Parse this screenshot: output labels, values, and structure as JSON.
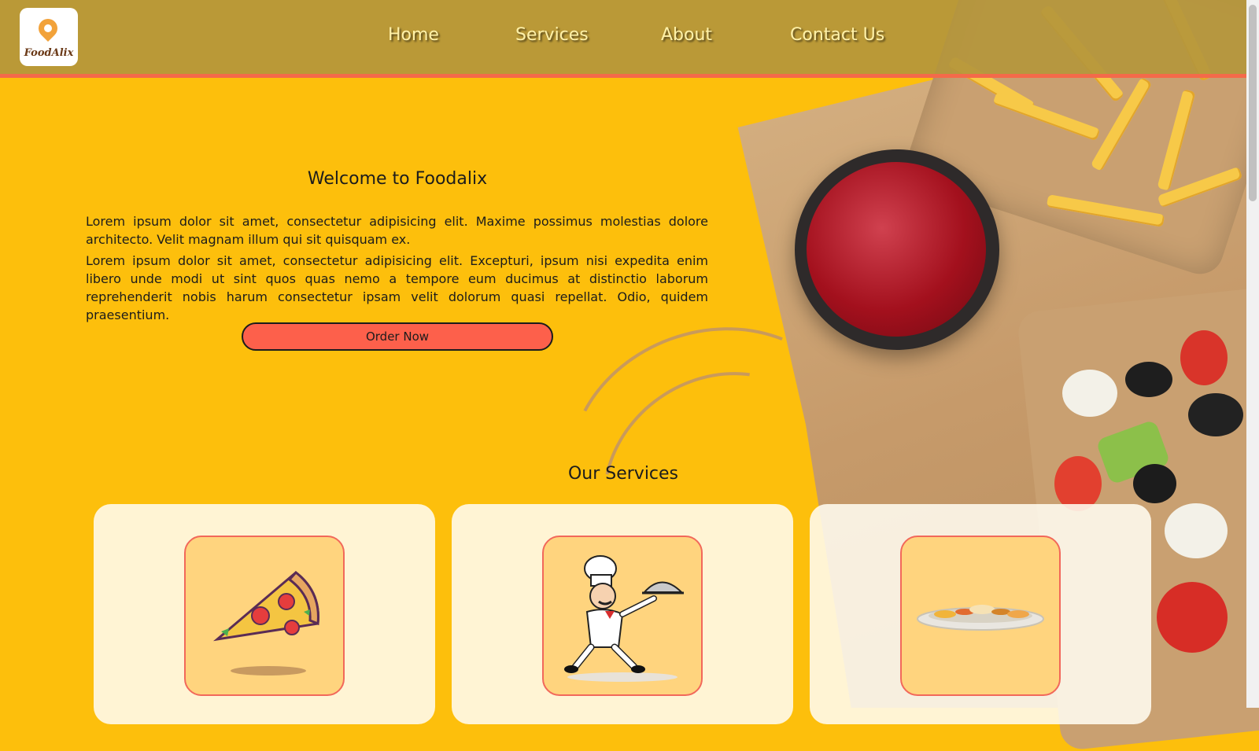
{
  "brand": {
    "logo_text": "FoodAlix"
  },
  "nav": {
    "items": [
      {
        "label": "Home"
      },
      {
        "label": "Services"
      },
      {
        "label": "About"
      },
      {
        "label": "Contact Us"
      }
    ]
  },
  "hero": {
    "title": "Welcome to Foodalix",
    "paragraph1": "Lorem ipsum dolor sit amet, consectetur adipisicing elit. Maxime possimus molestias dolore architecto. Velit magnam illum qui sit quisquam ex.",
    "paragraph2": "Lorem ipsum dolor sit amet, consectetur adipisicing elit. Excepturi, ipsum nisi expedita enim libero unde modi ut sint quos quas nemo a tempore eum ducimus at distinctio laborum reprehenderit nobis harum consectetur ipsam velit dolorum quasi repellat. Odio, quidem praesentium.",
    "order_button": "Order Now"
  },
  "services": {
    "title": "Our Services",
    "cards": [
      {
        "icon": "pizza-icon"
      },
      {
        "icon": "chef-icon"
      },
      {
        "icon": "thali-icon"
      }
    ]
  },
  "colors": {
    "background": "#FDBF0C",
    "header": "#B4963C",
    "accent": "#FD604B",
    "nav_text": "#FFF1A8"
  }
}
